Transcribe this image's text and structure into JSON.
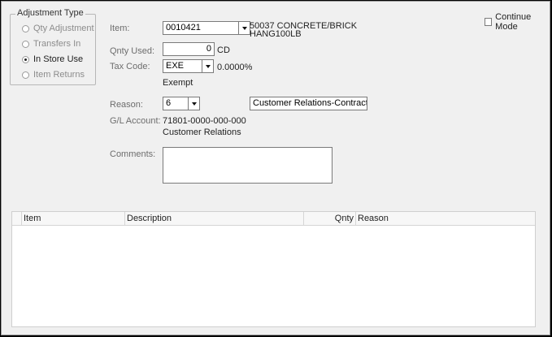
{
  "adjustment_type": {
    "title": "Adjustment Type",
    "options": [
      {
        "label": "Qty Adjustment",
        "checked": false,
        "enabled": false
      },
      {
        "label": "Transfers In",
        "checked": false,
        "enabled": false
      },
      {
        "label": "In Store Use",
        "checked": true,
        "enabled": true
      },
      {
        "label": "Item Returns",
        "checked": false,
        "enabled": false
      }
    ]
  },
  "continue_mode": {
    "label": "Continue Mode",
    "checked": false
  },
  "item": {
    "label": "Item:",
    "value": "0010421",
    "description_line1": "50037 CONCRETE/BRICK",
    "description_line2": "HANG100LB"
  },
  "qnty_used": {
    "label": "Qnty Used:",
    "value": "0",
    "unit": "CD"
  },
  "tax_code": {
    "label": "Tax Code:",
    "value": "EXE",
    "rate": "0.0000%",
    "description": "Exempt"
  },
  "reason": {
    "label": "Reason:",
    "value": "6",
    "description": "Customer Relations-Contractors"
  },
  "gl_account": {
    "label": "G/L Account:",
    "value": "71801-0000-000-000",
    "description": "Customer Relations"
  },
  "comments": {
    "label": "Comments:",
    "value": ""
  },
  "grid": {
    "columns": [
      "Item",
      "Description",
      "Qnty",
      "Reason"
    ],
    "rows": []
  }
}
